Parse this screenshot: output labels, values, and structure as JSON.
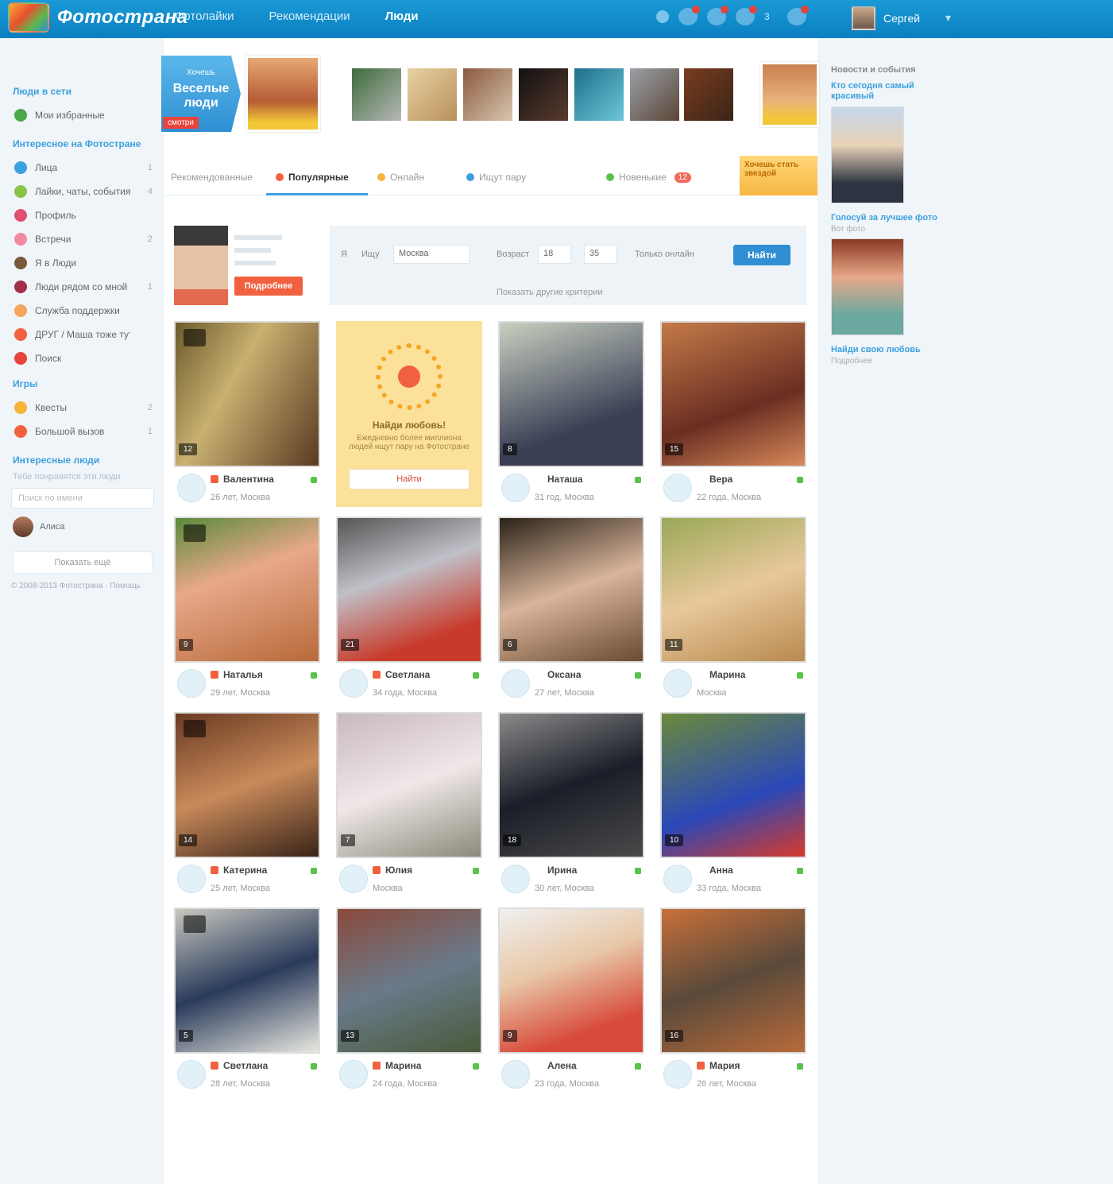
{
  "header": {
    "logo_text": "Фотострана",
    "nav": [
      "Фотолайки",
      "Рекомендации",
      "Люди"
    ],
    "user_name": "Сергей",
    "notif_count": "3"
  },
  "left": {
    "section1_title": "Люди в сети",
    "section1_items": [
      {
        "label": "Мои избранные"
      }
    ],
    "section2_title": "Интересное на Фотостране",
    "menu": [
      {
        "label": "Лица",
        "count": "1"
      },
      {
        "label": "Лайки, чаты, события",
        "count": "4"
      },
      {
        "label": "Профиль",
        "count": ""
      },
      {
        "label": "Встречи",
        "count": "2"
      },
      {
        "label": "Я в Люди",
        "count": ""
      },
      {
        "label": "Люди рядом со мной",
        "count": "1"
      },
      {
        "label": "Служба поддержки",
        "count": ""
      },
      {
        "label": "ДРУГ / Маша тоже тут",
        "count": ""
      },
      {
        "label": "Поиск",
        "count": ""
      }
    ],
    "section3_title": "Игры",
    "games": [
      {
        "label": "Квесты",
        "count": "2"
      },
      {
        "label": "Большой вызов",
        "count": "1"
      }
    ],
    "section4_title": "Интересные люди",
    "sub": "Тебе понравятся эти люди",
    "search_placeholder": "Поиск по имени",
    "friend_name": "Алиса",
    "button_label": "Показать ещё",
    "footer": "© 2008-2013 Фотострана · Помощь"
  },
  "promo": {
    "line1": "Хочешь",
    "line2": "Веселые люди",
    "badge": "смотри"
  },
  "tabs": [
    {
      "label": "Рекомендованные"
    },
    {
      "label": "Популярные",
      "active": true
    },
    {
      "label": "Онлайн"
    },
    {
      "label": "Ищут пару"
    },
    {
      "label": "Новенькие",
      "badge": "12"
    }
  ],
  "tab_promo": "Хочешь стать звездой",
  "me": {
    "cta": "Подробнее"
  },
  "filter": {
    "label_me": "Я",
    "gender": "Ищу",
    "city": "Москва",
    "age_label": "Возраст",
    "age_from": "18",
    "age_to": "35",
    "online_label": "Только онлайн",
    "search_button": "Найти",
    "more_link": "Показать другие критерии"
  },
  "cards": [
    {
      "name": "Валентина",
      "meta": "26 лет, Москва",
      "photos": "12",
      "heart": true
    },
    {
      "ad": true,
      "title": "Найди любовь!",
      "text": "Ежедневно более миллиона людей ищут пару на Фотостране",
      "button": "Найти"
    },
    {
      "name": "Наташа",
      "meta": "31 год, Москва",
      "photos": "8",
      "heart": false
    },
    {
      "name": "Вера",
      "meta": "22 года, Москва",
      "photos": "15",
      "heart": false
    },
    {
      "name": "Наталья",
      "meta": "29 лет, Москва",
      "photos": "9",
      "heart": true
    },
    {
      "name": "Светлана",
      "meta": "34 года, Москва",
      "photos": "21",
      "heart": true
    },
    {
      "name": "Оксана",
      "meta": "27 лет, Москва",
      "photos": "6",
      "heart": false
    },
    {
      "name": "Марина",
      "meta": "Москва",
      "photos": "11",
      "heart": false
    },
    {
      "name": "Катерина",
      "meta": "25 лет, Москва",
      "photos": "14",
      "heart": true
    },
    {
      "name": "Юлия",
      "meta": "Москва",
      "photos": "7",
      "heart": true
    },
    {
      "name": "Ирина",
      "meta": "30 лет, Москва",
      "photos": "18",
      "heart": false
    },
    {
      "name": "Анна",
      "meta": "33 года, Москва",
      "photos": "10",
      "heart": false
    },
    {
      "name": "Светлана",
      "meta": "28 лет, Москва",
      "photos": "5",
      "heart": true
    },
    {
      "name": "Марина",
      "meta": "24 года, Москва",
      "photos": "13",
      "heart": true
    },
    {
      "name": "Алена",
      "meta": "23 года, Москва",
      "photos": "9",
      "heart": false
    },
    {
      "name": "Мария",
      "meta": "26 лет, Москва",
      "photos": "16",
      "heart": true
    }
  ],
  "right": {
    "head": "Новости и события",
    "item1_title": "Кто сегодня самый красивый",
    "item2_title": "Голосуй за лучшее фото",
    "item2_sub": "Вот фото",
    "item3_title": "Найди свою любовь",
    "item3_sub": "Подробнее"
  }
}
